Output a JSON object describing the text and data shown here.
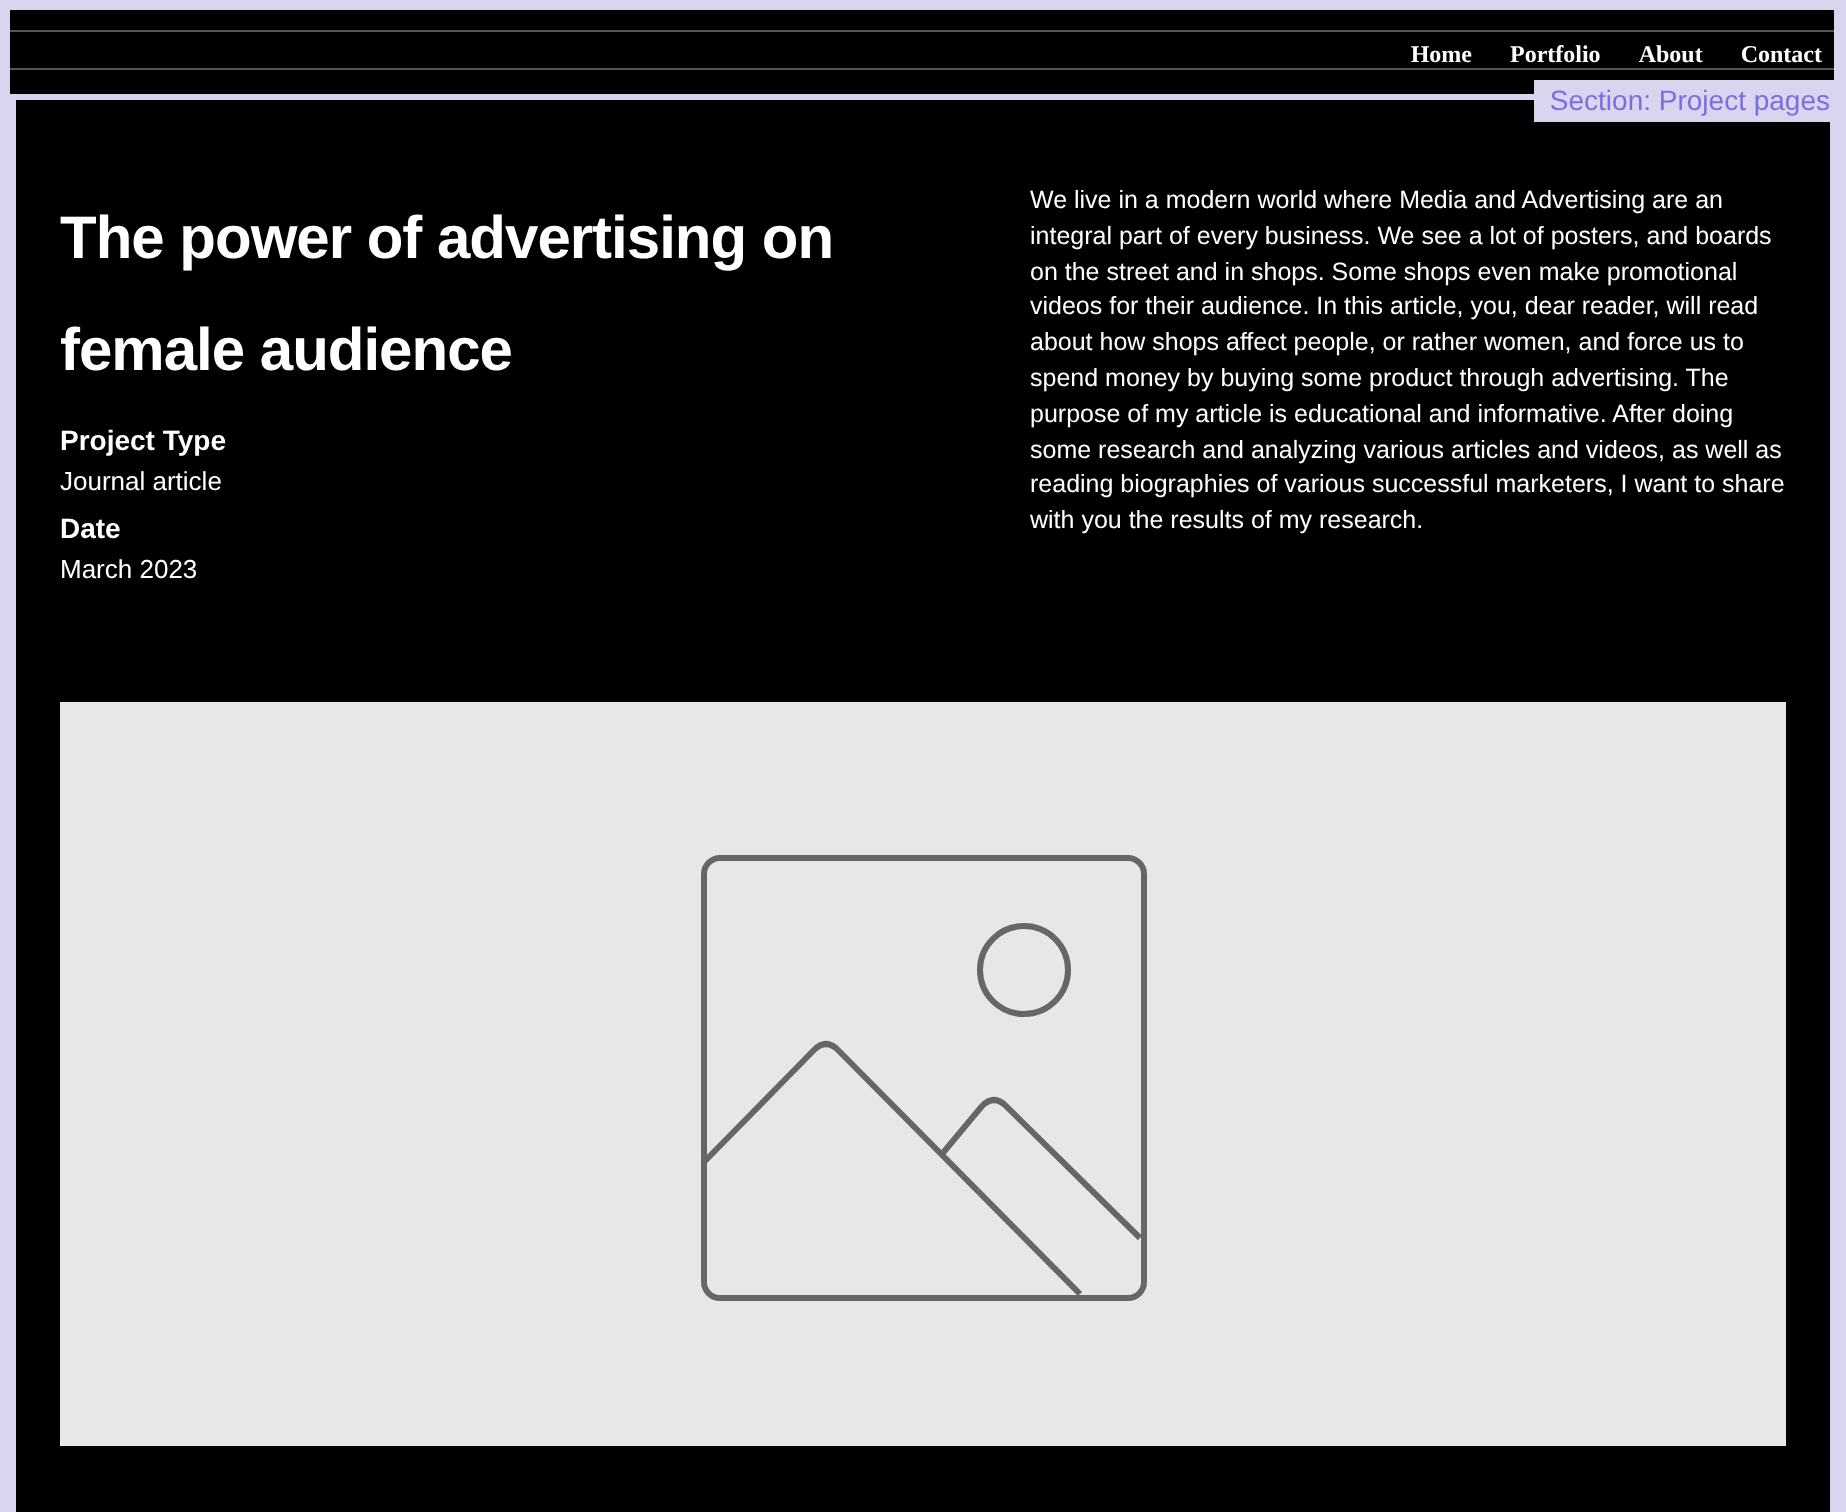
{
  "nav": {
    "items": [
      "Home",
      "Portfolio",
      "About",
      "Contact"
    ]
  },
  "section_tag": "Section: Project pages",
  "project": {
    "title": "The power of advertising on female audience",
    "details": [
      {
        "label": "Project Type",
        "value": "Journal article"
      },
      {
        "label": "Date",
        "value": "March 2023"
      }
    ],
    "description": "We live in a modern world where Media and Advertising are an integral part of every business. We see a lot of posters, and boards on the street and in shops. Some shops even make promotional videos for their audience. In this article, you, dear reader, will read about how shops affect people, or rather women, and force us to spend money by buying some product through advertising. The purpose of my article is educational and informative. After doing some research and analyzing various articles and videos, as well as reading biographies of various successful marketers, I want to share with you the results of my research."
  },
  "media": {
    "kind": "placeholder"
  }
}
